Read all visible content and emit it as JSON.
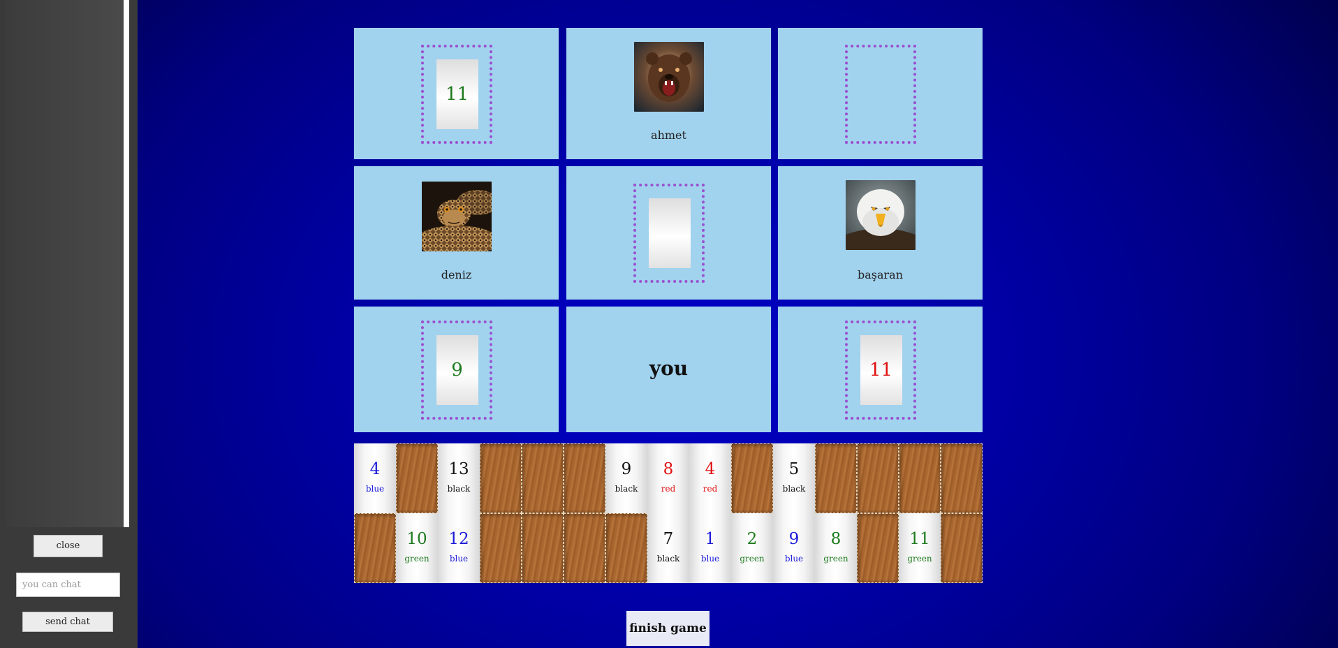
{
  "sidebar": {
    "close_label": "close",
    "chat_placeholder": "you can chat",
    "send_label": "send chat"
  },
  "board": {
    "top_left_tile": {
      "number": "11",
      "color": "#1e7a1e"
    },
    "top_center_player": {
      "name": "ahmet",
      "avatar": "bear-avatar"
    },
    "top_right_zone": {
      "empty": true
    },
    "mid_left_player": {
      "name": "deniz",
      "avatar": "snake-avatar"
    },
    "center_zone": {
      "tile_number": "",
      "color": "#111111"
    },
    "mid_right_player": {
      "name": "başaran",
      "avatar": "eagle-avatar"
    },
    "bottom_left_tile": {
      "number": "9",
      "color": "#1e7a1e"
    },
    "you_label": "you",
    "bottom_right_tile": {
      "number": "11",
      "color": "#e01010"
    }
  },
  "colors": {
    "blue": "#1a1ad8",
    "black": "#111111",
    "red": "#e01010",
    "green": "#1e7a1e"
  },
  "rack": {
    "row1": [
      {
        "number": "4",
        "color": "blue"
      },
      null,
      {
        "number": "13",
        "color": "black"
      },
      null,
      null,
      null,
      {
        "number": "9",
        "color": "black"
      },
      {
        "number": "8",
        "color": "red"
      },
      {
        "number": "4",
        "color": "red"
      },
      null,
      {
        "number": "5",
        "color": "black"
      },
      null,
      null,
      null,
      null
    ],
    "row2": [
      null,
      {
        "number": "10",
        "color": "green"
      },
      {
        "number": "12",
        "color": "blue"
      },
      null,
      null,
      null,
      null,
      {
        "number": "7",
        "color": "black"
      },
      {
        "number": "1",
        "color": "blue"
      },
      {
        "number": "2",
        "color": "green"
      },
      {
        "number": "9",
        "color": "blue"
      },
      {
        "number": "8",
        "color": "green"
      },
      null,
      {
        "number": "11",
        "color": "green"
      },
      null
    ]
  },
  "finish_label": "finish game"
}
